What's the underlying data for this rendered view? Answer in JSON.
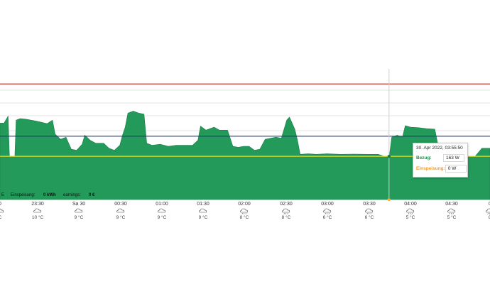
{
  "colors": {
    "area": "#23995a",
    "area_line": "#1a8048",
    "limit_red": "#c0392b",
    "line_navy": "#1f3b7a",
    "line_yellow": "#e8e021",
    "grid": "#e6e6e6",
    "cursor": "#cfcfcf",
    "marker": "#f39a2b"
  },
  "chart_data": {
    "type": "area",
    "x_ticks": [
      "0",
      "23:30",
      "Sa 30",
      "00:30",
      "01:00",
      "01:30",
      "02:00",
      "02:30",
      "03:00",
      "03:30",
      "04:00",
      "04:30",
      "0"
    ],
    "temperatures": [
      "C",
      "10 °C",
      "9 °C",
      "9 °C",
      "9 °C",
      "9 °C",
      "8 °C",
      "8 °C",
      "6 °C",
      "6 °C",
      "5 °C",
      "5 °C",
      "C"
    ],
    "weather_icons": [
      "cloud-icon",
      "cloud-icon",
      "cloud-icon",
      "cloud-icon",
      "cloud-icon",
      "cloud-icon",
      "cloud-rain-icon",
      "cloud-rain-icon",
      "cloud-rain-icon",
      "cloud-rain-icon",
      "cloud-rain-icon",
      "cloud-rain-icon",
      "cloud-rain-icon"
    ],
    "time_range_minutes": [
      -33,
      331
    ],
    "y_range_w": [
      0,
      1300
    ],
    "reference_lines_w": [
      {
        "value": 1150,
        "color": "#c0392b"
      },
      {
        "value": 630,
        "color": "#1f3b7a"
      },
      {
        "value": 430,
        "color": "#e8e021"
      }
    ],
    "series": [
      {
        "name": "Bezug",
        "points": [
          [
            -33,
            760
          ],
          [
            -30,
            760
          ],
          [
            -27,
            830
          ],
          [
            -26,
            430
          ],
          [
            -22,
            430
          ],
          [
            -21,
            790
          ],
          [
            -18,
            805
          ],
          [
            -14,
            800
          ],
          [
            -6,
            780
          ],
          [
            2,
            755
          ],
          [
            6,
            790
          ],
          [
            8,
            650
          ],
          [
            12,
            600
          ],
          [
            16,
            620
          ],
          [
            20,
            500
          ],
          [
            24,
            490
          ],
          [
            28,
            550
          ],
          [
            30,
            640
          ],
          [
            34,
            590
          ],
          [
            38,
            560
          ],
          [
            44,
            560
          ],
          [
            48,
            510
          ],
          [
            52,
            490
          ],
          [
            56,
            540
          ],
          [
            58,
            640
          ],
          [
            60,
            720
          ],
          [
            62,
            860
          ],
          [
            66,
            880
          ],
          [
            70,
            860
          ],
          [
            74,
            850
          ],
          [
            76,
            560
          ],
          [
            80,
            540
          ],
          [
            86,
            550
          ],
          [
            92,
            530
          ],
          [
            98,
            540
          ],
          [
            104,
            540
          ],
          [
            110,
            540
          ],
          [
            114,
            590
          ],
          [
            116,
            730
          ],
          [
            120,
            690
          ],
          [
            126,
            720
          ],
          [
            130,
            690
          ],
          [
            136,
            690
          ],
          [
            140,
            530
          ],
          [
            144,
            520
          ],
          [
            148,
            530
          ],
          [
            152,
            530
          ],
          [
            156,
            490
          ],
          [
            160,
            500
          ],
          [
            164,
            600
          ],
          [
            168,
            610
          ],
          [
            172,
            620
          ],
          [
            176,
            610
          ],
          [
            180,
            790
          ],
          [
            182,
            820
          ],
          [
            186,
            700
          ],
          [
            188,
            590
          ],
          [
            190,
            450
          ],
          [
            196,
            455
          ],
          [
            202,
            450
          ],
          [
            210,
            455
          ],
          [
            220,
            450
          ],
          [
            230,
            452
          ],
          [
            240,
            450
          ],
          [
            248,
            450
          ],
          [
            252,
            432
          ],
          [
            256,
            420
          ],
          [
            257,
            510
          ],
          [
            258,
            620
          ],
          [
            262,
            640
          ],
          [
            266,
            620
          ],
          [
            268,
            735
          ],
          [
            272,
            720
          ],
          [
            278,
            715
          ],
          [
            284,
            705
          ],
          [
            290,
            700
          ],
          [
            294,
            432
          ],
          [
            300,
            432
          ],
          [
            310,
            430
          ],
          [
            320,
            430
          ],
          [
            325,
            510
          ],
          [
            331,
            510
          ]
        ]
      }
    ],
    "cursor": {
      "minutes": 256,
      "marker_label": "Einspeisung",
      "marker_value_w": 0
    }
  },
  "legend": {
    "cut_text": "E",
    "einspeisung_label": "Einspeisung:",
    "einspeisung_value": "0 kWh",
    "earnings_label": "earnings:",
    "earnings_value": "0 €"
  },
  "tooltip": {
    "date": "30. Apr 2022, 03:55:50",
    "bezug_label": "Bezug:",
    "bezug_value": "163 W",
    "einspeisung_label": "Einspeisung:",
    "einspeisung_value": "0 W"
  }
}
